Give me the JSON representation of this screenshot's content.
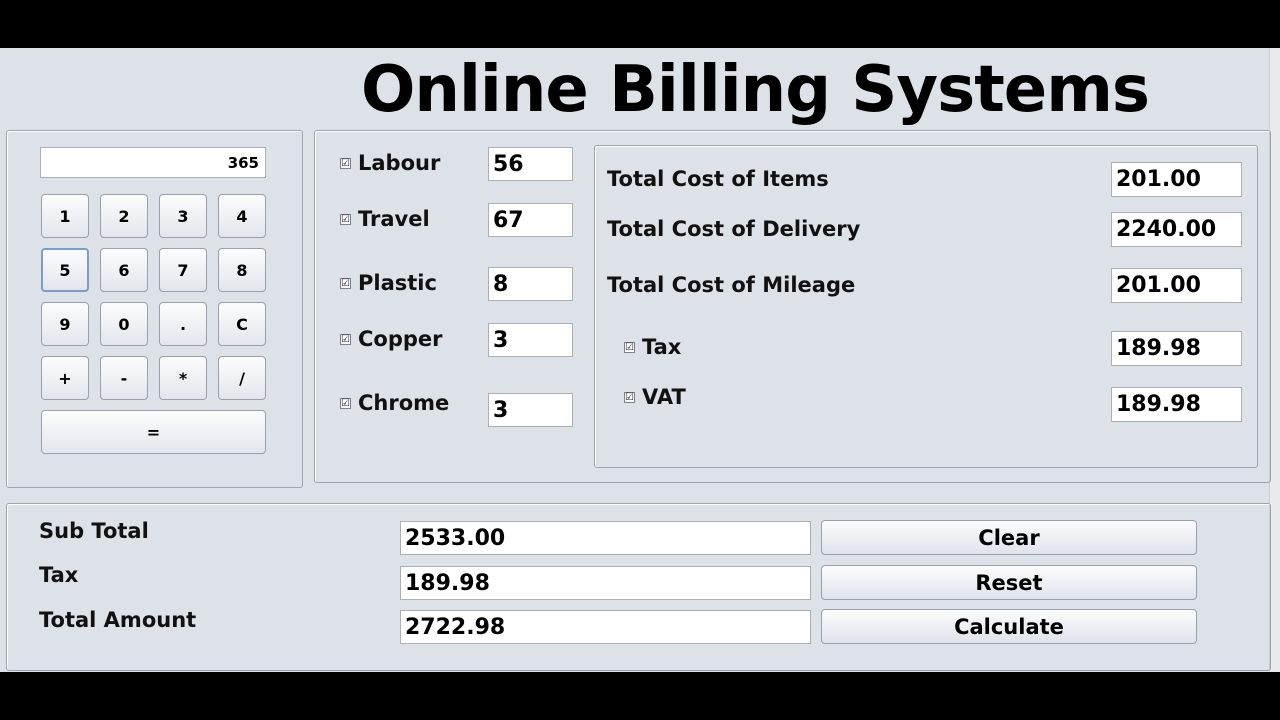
{
  "title": "Online Billing Systems",
  "calculator": {
    "display": "365",
    "keys": [
      "1",
      "2",
      "3",
      "4",
      "5",
      "6",
      "7",
      "8",
      "9",
      "0",
      ".",
      "C",
      "+",
      "-",
      "*",
      "/"
    ],
    "equals": "="
  },
  "items": [
    {
      "label": "Labour",
      "value": "56",
      "checked": true
    },
    {
      "label": "Travel",
      "value": "67",
      "checked": true
    },
    {
      "label": "Plastic",
      "value": "8",
      "checked": true
    },
    {
      "label": "Copper",
      "value": "3",
      "checked": true
    },
    {
      "label": "Chrome",
      "value": "3",
      "checked": true
    }
  ],
  "costs": [
    {
      "label": "Total Cost of Items",
      "value": "201.00"
    },
    {
      "label": "Total Cost of Delivery",
      "value": "2240.00"
    },
    {
      "label": "Total Cost of Mileage",
      "value": "201.00"
    }
  ],
  "charges": [
    {
      "label": "Tax",
      "value": "189.98",
      "checked": true
    },
    {
      "label": "VAT",
      "value": "189.98",
      "checked": true
    }
  ],
  "totals": [
    {
      "label": "Sub Total",
      "value": "2533.00"
    },
    {
      "label": "Tax",
      "value": "189.98"
    },
    {
      "label": "Total Amount",
      "value": "2722.98"
    }
  ],
  "buttons": {
    "clear": "Clear",
    "reset": "Reset",
    "calculate": "Calculate"
  },
  "checkmark": "☑"
}
